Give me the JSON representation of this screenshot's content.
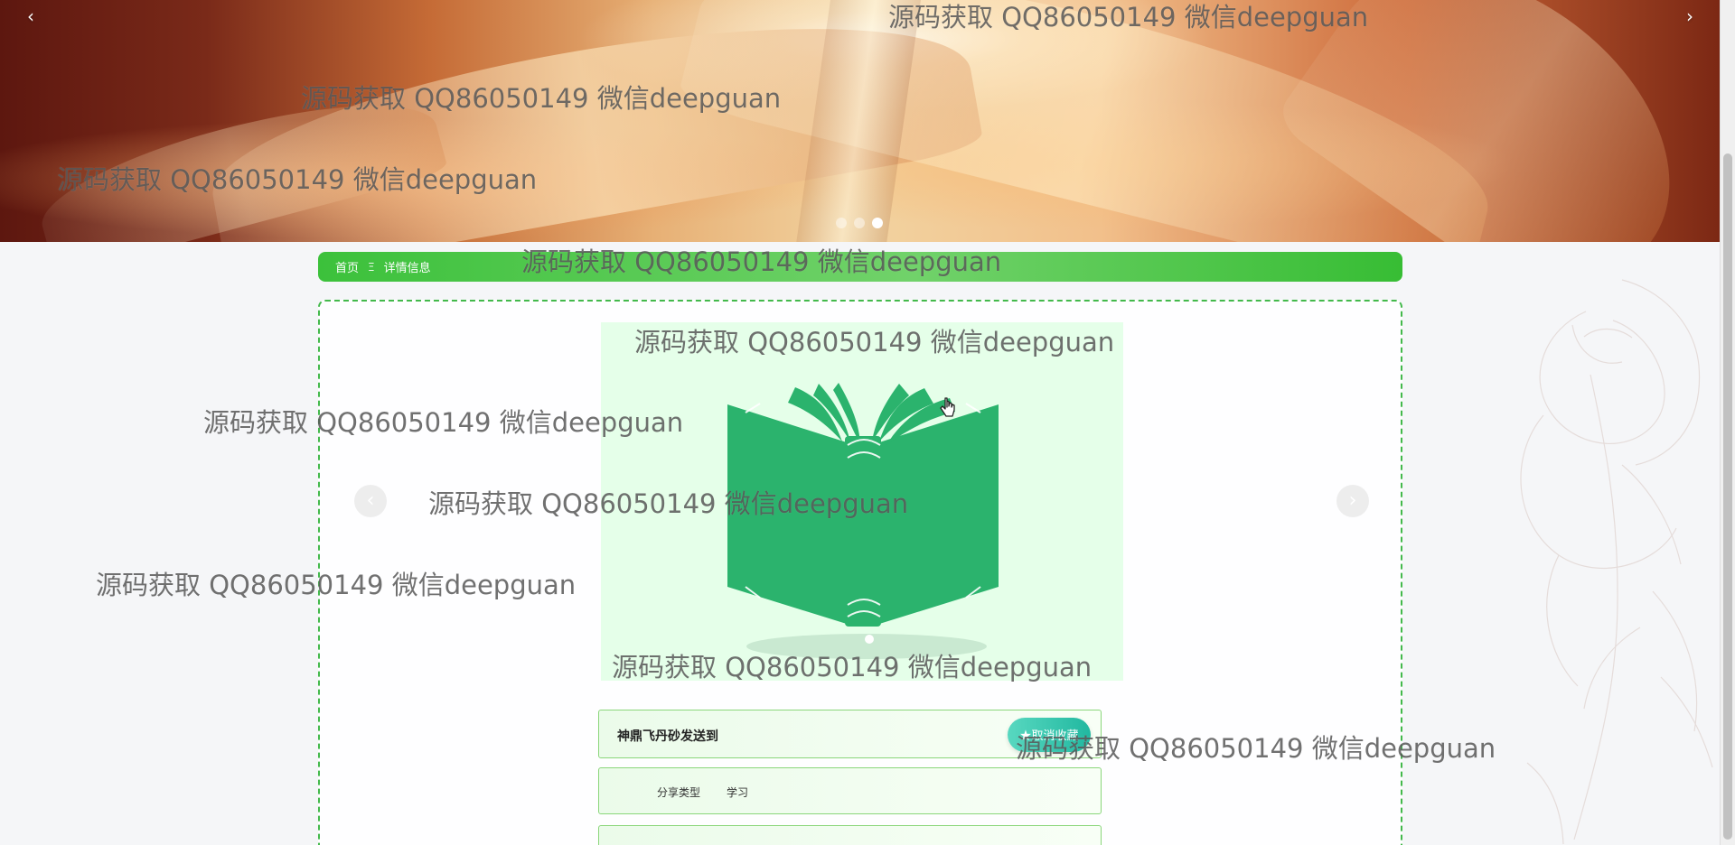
{
  "hero": {
    "prev_arrow": "‹",
    "next_arrow": "›",
    "dots": [
      "",
      "",
      ""
    ],
    "active_dot_index": 2
  },
  "breadcrumb": {
    "home": "首页",
    "separator": "Ξ",
    "current": "详情信息"
  },
  "detail": {
    "carousel_prev": "‹",
    "carousel_next": "›",
    "title": "神鼎飞丹砂发送到",
    "favorite_button": "★取消收藏",
    "share_type_label": "分享类型",
    "share_type_value": "学习"
  },
  "watermarks": [
    "源码获取 QQ86050149 微信deepguan",
    "源码获取 QQ86050149 微信deepguan",
    "源码获取 QQ86050149 微信deepguan",
    "源码获取 QQ86050149 微信deepguan",
    "源码获取 QQ86050149 微信deepguan",
    "源码获取 QQ86050149 微信deepguan",
    "源码获取 QQ86050149 微信deepguan",
    "源码获取 QQ86050149 微信deepguan",
    "源码获取 QQ86050149 微信deepguan",
    "源码获取 QQ86050149 微信deepguan"
  ],
  "icons": {
    "book": "book-icon",
    "flower": "flower-decoration-icon",
    "cursor": "pointer-cursor-icon"
  },
  "colors": {
    "accent_green": "#3cc13b",
    "book_green": "#2bb36d",
    "favorite_teal": "#21b8a0",
    "border_green": "#43b94b"
  }
}
